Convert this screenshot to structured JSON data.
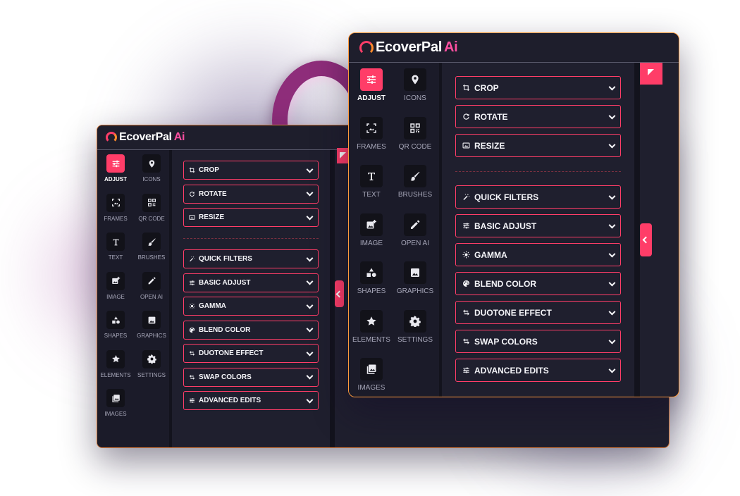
{
  "brand": {
    "name": "EcoverPal",
    "ai": "Ai"
  },
  "colors": {
    "accent": "#ff3d68",
    "panel_bg": "#1f1f2e",
    "rail_bg": "#121219",
    "border_warm": "#ff9a3c"
  },
  "tools": [
    {
      "label": "ADJUST",
      "icon": "sliders-icon",
      "active": true
    },
    {
      "label": "ICONS",
      "icon": "map-pin-icon"
    },
    {
      "label": "FRAMES",
      "icon": "frame-icon"
    },
    {
      "label": "QR CODE",
      "icon": "qr-code-icon"
    },
    {
      "label": "TEXT",
      "icon": "text-icon"
    },
    {
      "label": "BRUSHES",
      "icon": "brush-icon"
    },
    {
      "label": "IMAGE",
      "icon": "add-image-icon"
    },
    {
      "label": "OPEN AI",
      "icon": "pencil-icon"
    },
    {
      "label": "SHAPES",
      "icon": "shapes-icon"
    },
    {
      "label": "GRAPHICS",
      "icon": "graphics-icon"
    },
    {
      "label": "ELEMENTS",
      "icon": "star-icon"
    },
    {
      "label": "SETTINGS",
      "icon": "gear-icon"
    },
    {
      "label": "IMAGES",
      "icon": "images-icon"
    }
  ],
  "transform_items": [
    {
      "label": "CROP",
      "icon": "crop-icon"
    },
    {
      "label": "ROTATE",
      "icon": "rotate-icon"
    },
    {
      "label": "RESIZE",
      "icon": "resize-icon"
    }
  ],
  "filter_items": [
    {
      "label": "QUICK FILTERS",
      "icon": "magic-wand-icon"
    },
    {
      "label": "BASIC ADJUST",
      "icon": "sliders-icon"
    },
    {
      "label": "GAMMA",
      "icon": "sun-icon"
    },
    {
      "label": "BLEND COLOR",
      "icon": "palette-icon"
    },
    {
      "label": "DUOTONE EFFECT",
      "icon": "swap-arrows-icon"
    },
    {
      "label": "SWAP COLORS",
      "icon": "swap-arrows-icon"
    },
    {
      "label": "ADVANCED EDITS",
      "icon": "sliders-icon"
    }
  ]
}
